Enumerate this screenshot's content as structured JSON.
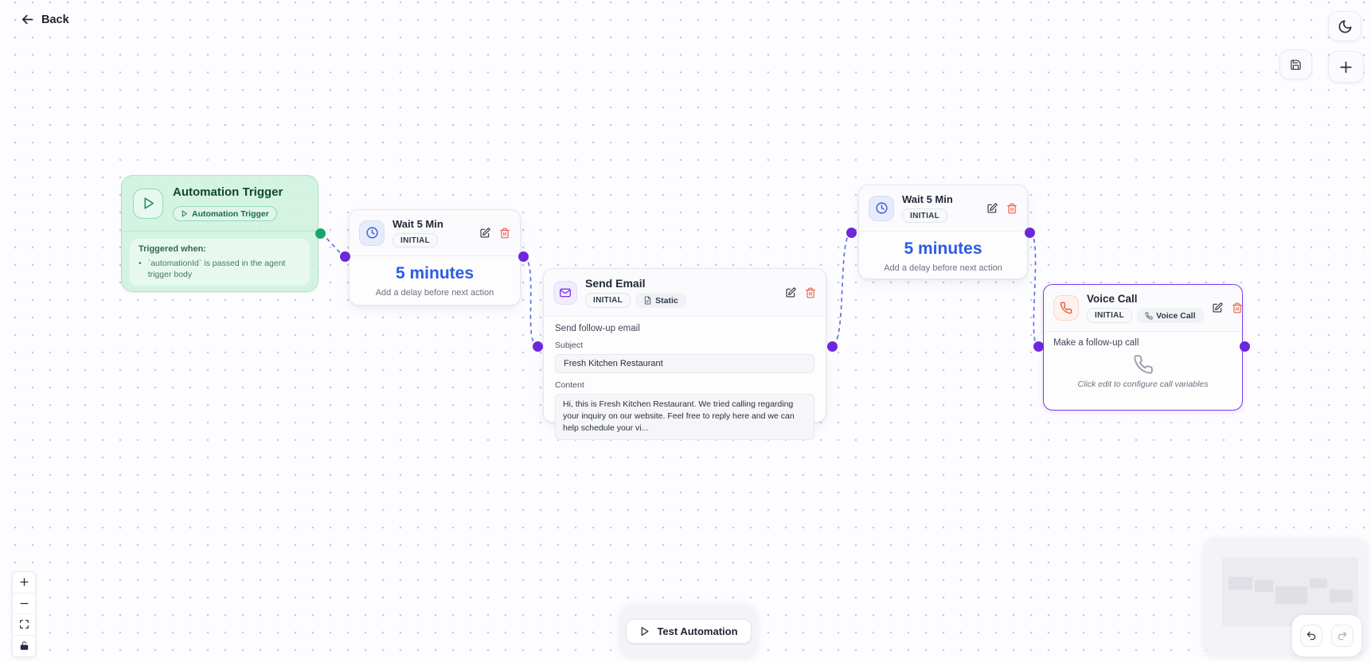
{
  "top_bar": {
    "back_label": "Back"
  },
  "nodes": {
    "trigger": {
      "title": "Automation Trigger",
      "badge": "Automation Trigger",
      "body_heading": "Triggered when:",
      "bullet": "•",
      "body_text": "`automationId` is passed in the agent trigger body"
    },
    "wait1": {
      "title": "Wait 5 Min",
      "badge": "INITIAL",
      "value": "5 minutes",
      "caption": "Add a delay before next action"
    },
    "wait2": {
      "title": "Wait 5 Min",
      "badge": "INITIAL",
      "value": "5 minutes",
      "caption": "Add a delay before next action"
    },
    "email": {
      "title": "Send Email",
      "badge_initial": "INITIAL",
      "badge_type": "Static",
      "description": "Send follow-up email",
      "subject_label": "Subject",
      "subject_value": "Fresh Kitchen Restaurant",
      "content_label": "Content",
      "content_value": "Hi, this is Fresh Kitchen Restaurant. We tried calling regarding your inquiry on our website. Feel free to reply here and we can help schedule your vi..."
    },
    "voice": {
      "title": "Voice Call",
      "badge_initial": "INITIAL",
      "badge_type": "Voice Call",
      "description": "Make a follow-up call",
      "caption": "Click edit to configure call variables"
    }
  },
  "footer": {
    "test_button_label": "Test Automation"
  },
  "colors": {
    "accent_blue": "#2b5ce6",
    "accent_purple": "#7c3aed",
    "accent_green": "#18a46d",
    "accent_red": "#e8604c",
    "edge": "#6070e8"
  }
}
